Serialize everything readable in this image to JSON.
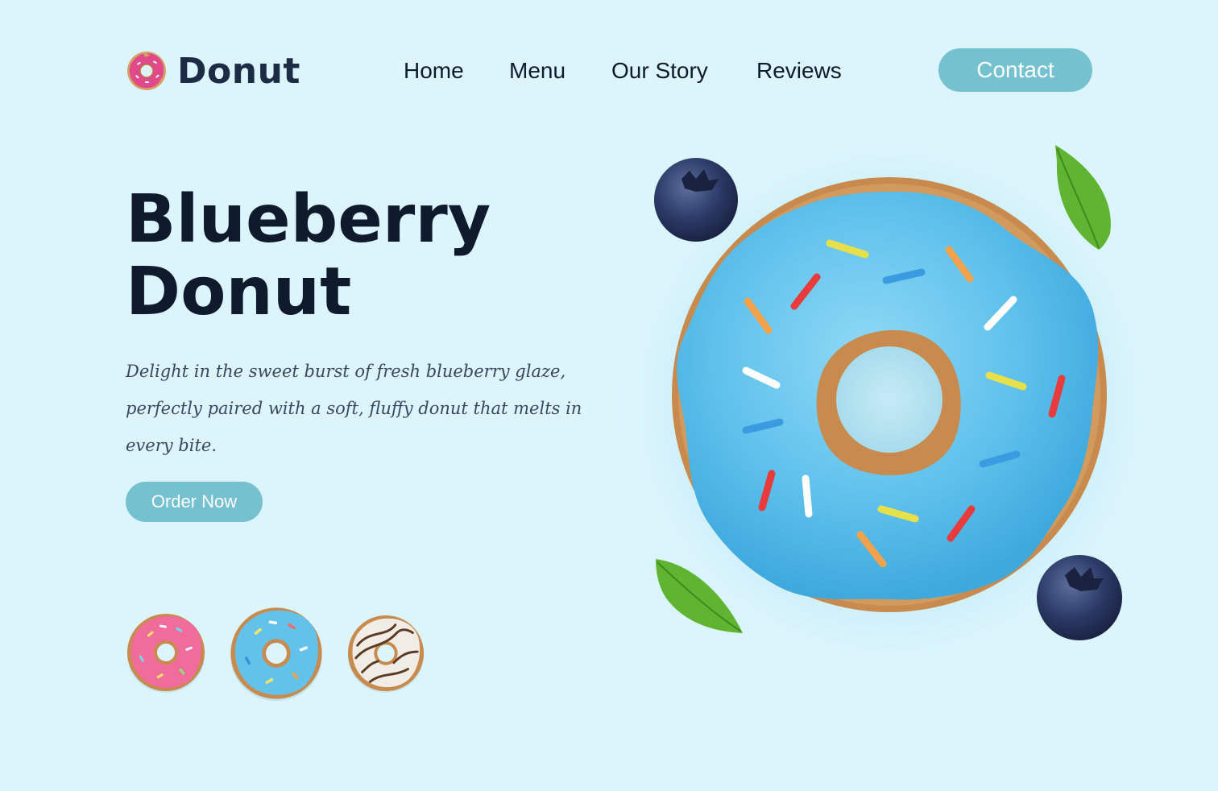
{
  "brand": {
    "name": "Donut",
    "icon": "donut-logo-icon"
  },
  "nav": {
    "items": [
      {
        "label": "Home"
      },
      {
        "label": "Menu"
      },
      {
        "label": "Our Story"
      },
      {
        "label": "Reviews"
      }
    ],
    "contact_label": "Contact"
  },
  "hero": {
    "title_line1": "Blueberry",
    "title_line2": "Donut",
    "description": "Delight in the sweet burst of fresh blueberry glaze, perfectly paired with a soft, fluffy donut that melts in every bite.",
    "cta_label": "Order Now"
  },
  "variants": [
    {
      "icon": "pink-donut-icon"
    },
    {
      "icon": "blue-donut-icon"
    },
    {
      "icon": "chocolate-drizzle-donut-icon"
    }
  ],
  "colors": {
    "background": "#dcf5fd",
    "accent": "#75c1d0",
    "heading": "#0f1b2d",
    "body_text": "#3a4760",
    "glaze_blue": "#62c2ea",
    "dough": "#c98a4e"
  }
}
